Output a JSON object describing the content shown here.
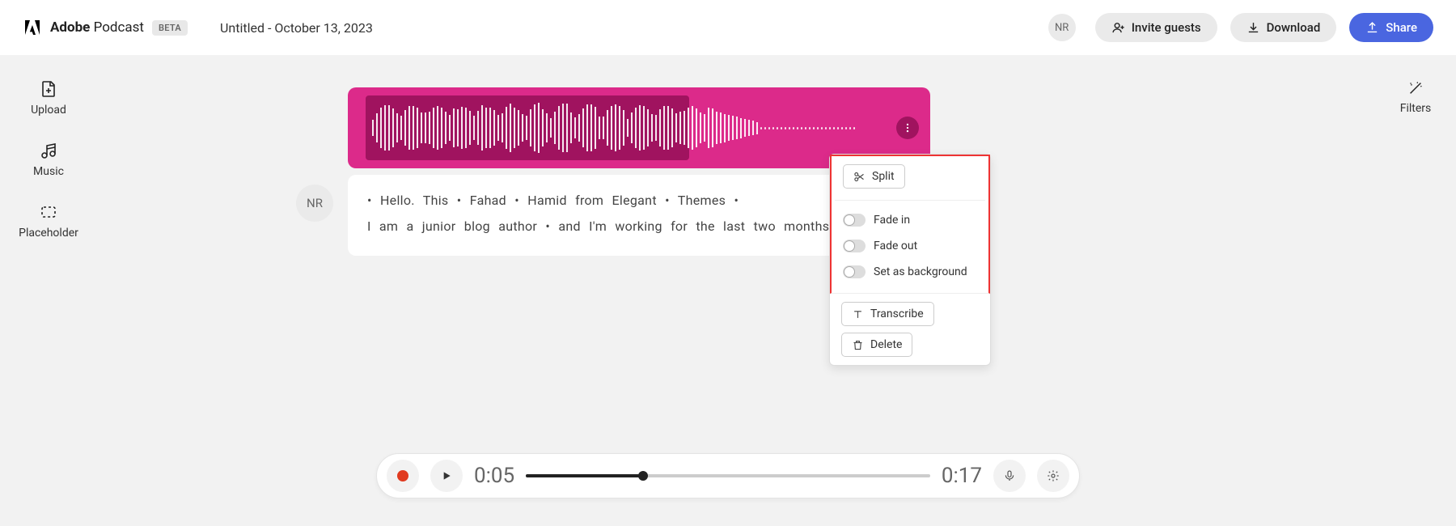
{
  "header": {
    "brand_bold": "Adobe",
    "brand_light": "Podcast",
    "beta": "BETA",
    "doc_title": "Untitled - October 13, 2023",
    "avatar": "NR",
    "invite": "Invite guests",
    "download": "Download",
    "share": "Share"
  },
  "sidebar": {
    "upload": "Upload",
    "music": "Music",
    "placeholder": "Placeholder",
    "filters": "Filters"
  },
  "transcript": {
    "avatar": "NR",
    "line1": "• Hello.  This • Fahad • Hamid  from  Elegant • Themes •",
    "line2": "I  am  a  junior  blog  author • and  I'm  working  for  the  last  two  months. •"
  },
  "context_menu": {
    "split": "Split",
    "fade_in": "Fade in",
    "fade_out": "Fade out",
    "set_bg": "Set as background",
    "transcribe": "Transcribe",
    "delete": "Delete"
  },
  "player": {
    "current": "0:05",
    "total": "0:17",
    "progress_pct": 29
  }
}
